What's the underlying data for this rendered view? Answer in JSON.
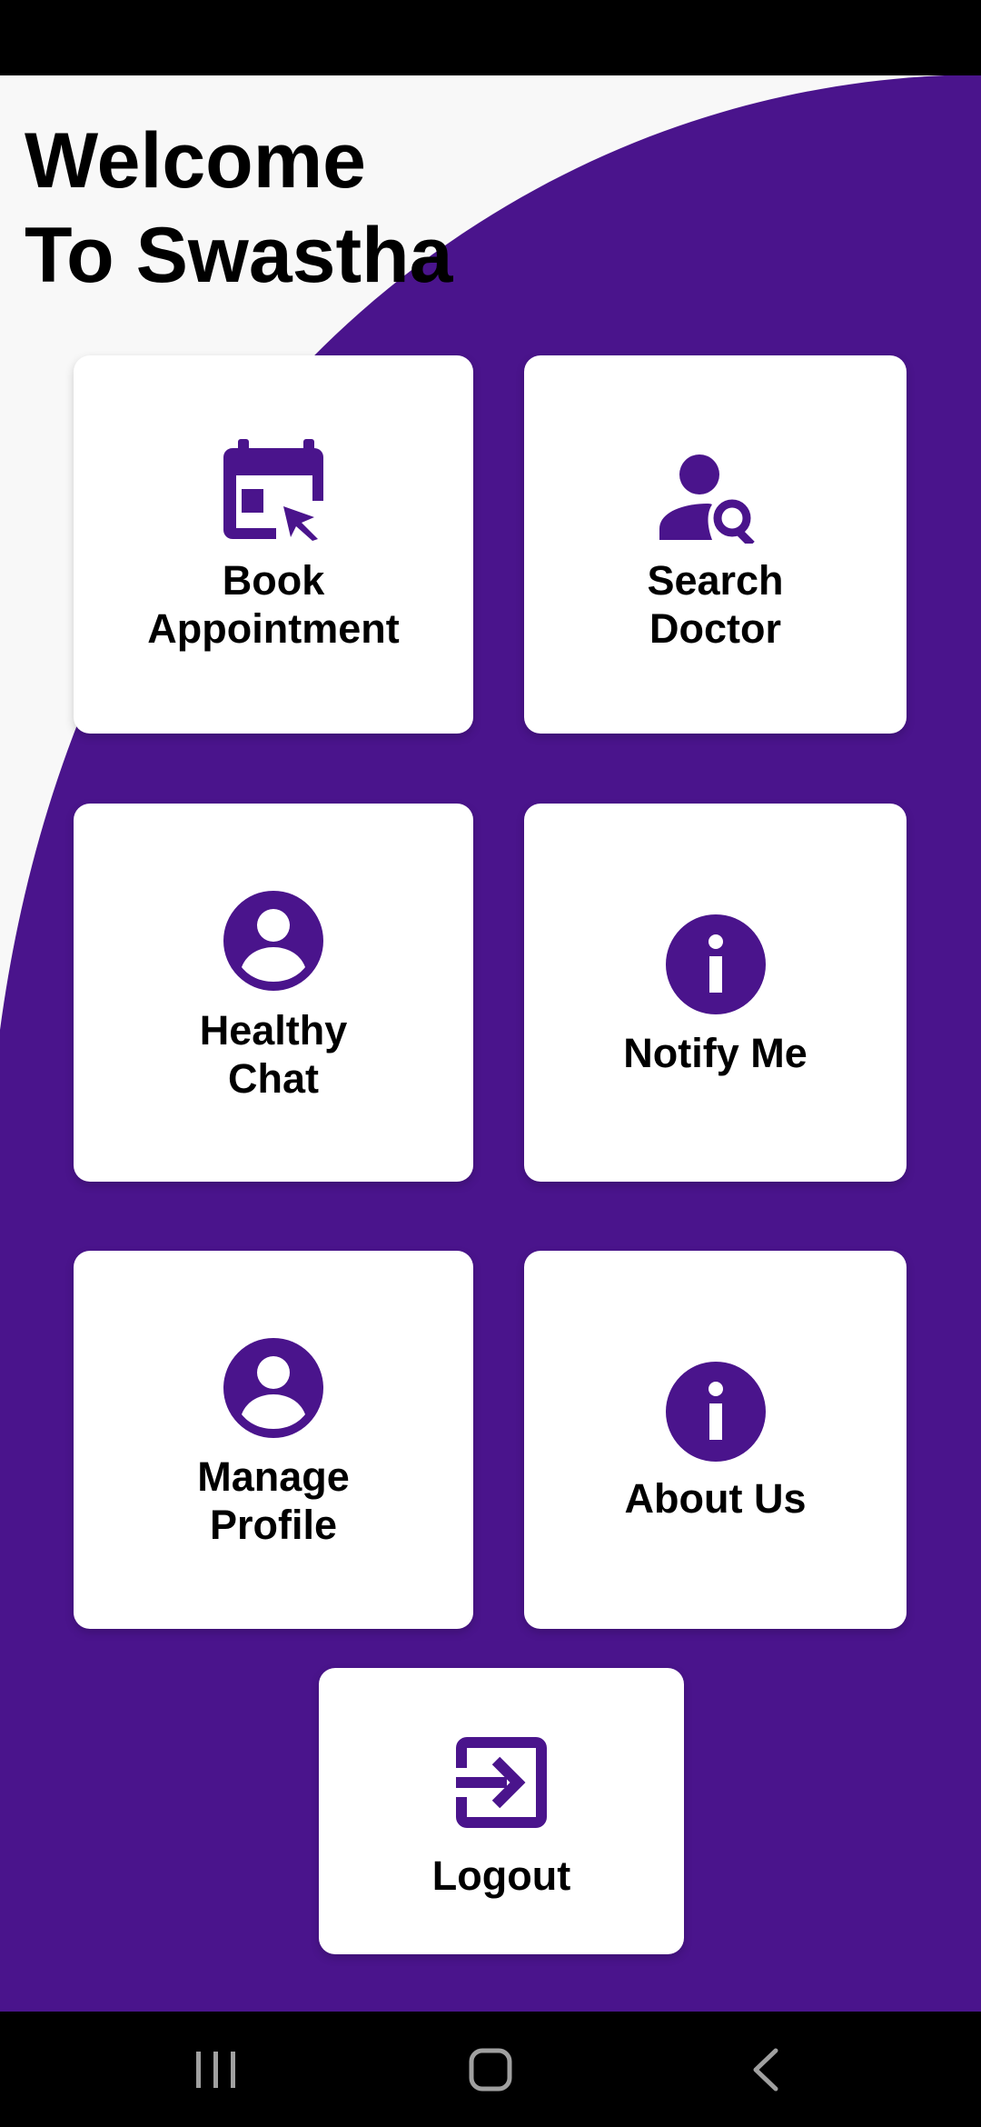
{
  "app": {
    "title_line1": "Welcome",
    "title_line2": "To Swastha"
  },
  "colors": {
    "primary": "#4a148c",
    "card": "#ffffff",
    "background": "#f8f8f8",
    "text": "#000000",
    "system_bars": "#000000"
  },
  "menu": {
    "book_appointment": {
      "line1": "Book",
      "line2": "Appointment",
      "icon": "calendar-click-icon"
    },
    "search_doctor": {
      "line1": "Search",
      "line2": "Doctor",
      "icon": "person-search-icon"
    },
    "healthy_chat": {
      "line1": "Healthy",
      "line2": "Chat",
      "icon": "account-circle-icon"
    },
    "notify_me": {
      "line1": "Notify Me",
      "icon": "info-icon"
    },
    "manage_profile": {
      "line1": "Manage",
      "line2": "Profile",
      "icon": "account-circle-icon"
    },
    "about_us": {
      "line1": "About Us",
      "icon": "info-icon"
    },
    "logout": {
      "line1": "Logout",
      "icon": "logout-icon"
    }
  },
  "navigation": {
    "recents_icon": "recents-icon",
    "home_icon": "home-icon",
    "back_icon": "back-icon"
  }
}
